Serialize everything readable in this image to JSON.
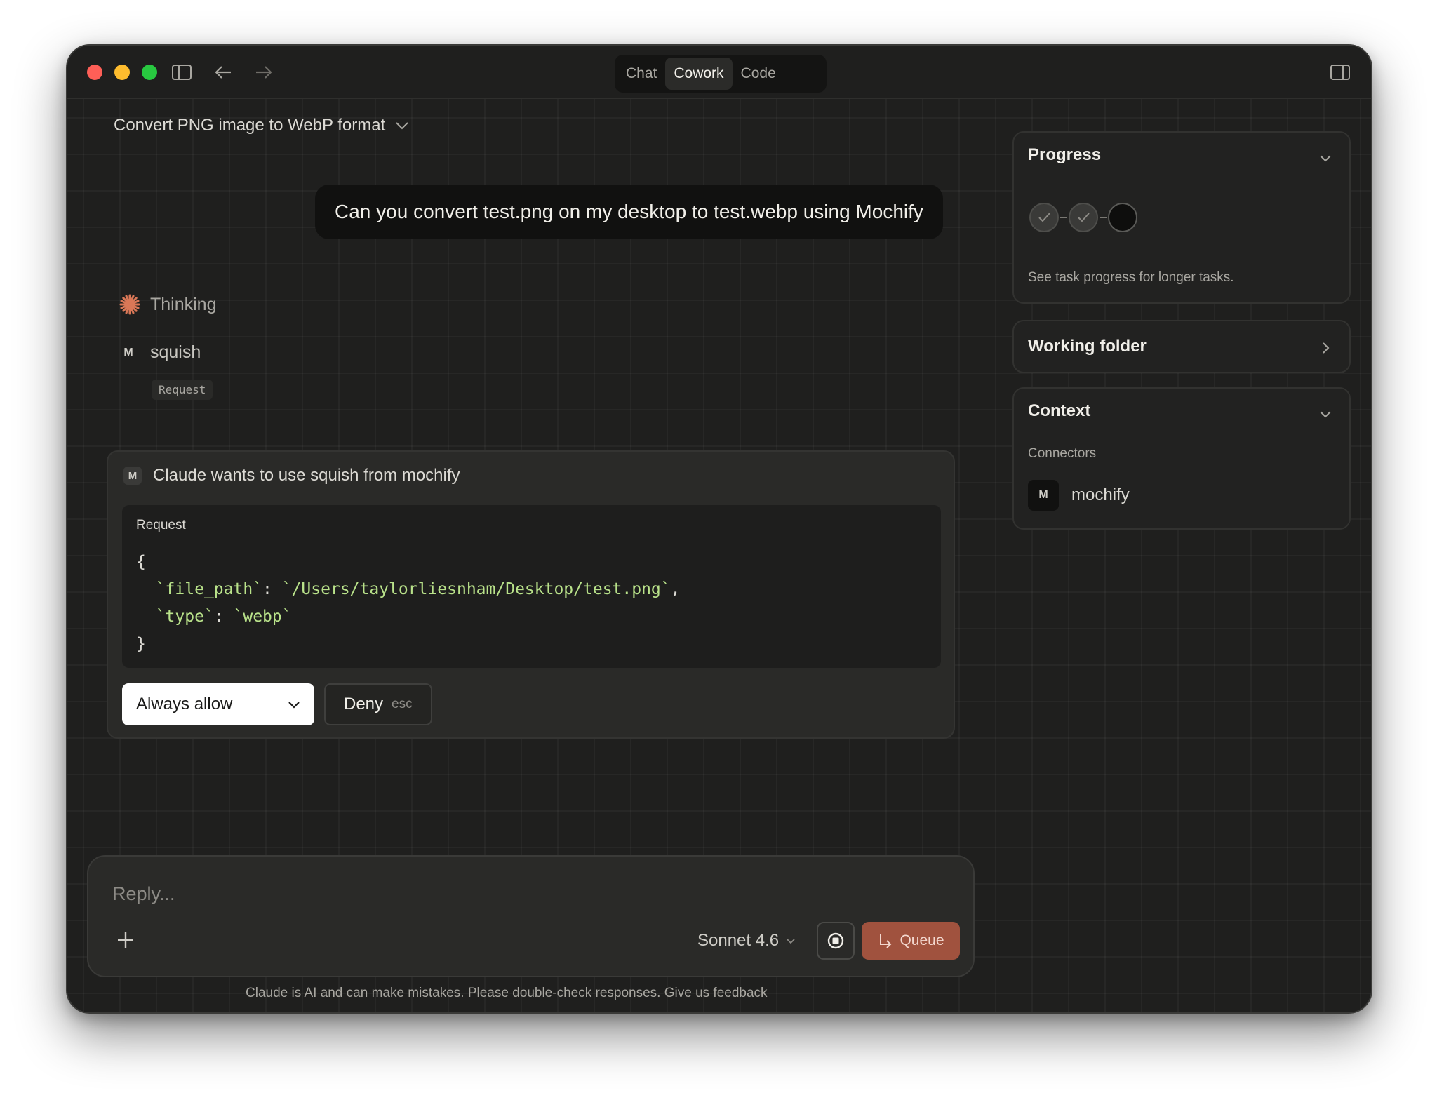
{
  "titlebar": {
    "tabs": [
      {
        "label": "Chat",
        "active": false
      },
      {
        "label": "Cowork",
        "active": true
      },
      {
        "label": "Code",
        "active": false
      }
    ]
  },
  "conversation": {
    "title": "Convert PNG image to WebP format",
    "user_message": "Can you convert test.png on my desktop to test.webp using Mochify",
    "thinking_label": "Thinking",
    "tool_badge": "M",
    "tool_name": "squish",
    "request_tag": "Request"
  },
  "permission": {
    "badge": "M",
    "heading": "Claude wants to use squish from mochify",
    "request_label": "Request",
    "code": {
      "open": "{",
      "key1": "`file_path`",
      "val1": "`/Users/taylorliesnham/Desktop/test.png`",
      "key2": "`type`",
      "val2": "`webp`",
      "close": "}"
    },
    "allow_label": "Always allow",
    "deny_label": "Deny",
    "deny_shortcut": "esc"
  },
  "composer": {
    "placeholder": "Reply...",
    "model": "Sonnet 4.6",
    "queue_label": "Queue"
  },
  "footer": {
    "disclaimer": "Claude is AI and can make mistakes. Please double-check responses.",
    "feedback_link": "Give us feedback"
  },
  "sidebar": {
    "progress": {
      "title": "Progress",
      "steps_completed": 2,
      "steps_total": 3,
      "description": "See task progress for longer tasks."
    },
    "working_folder": {
      "title": "Working folder"
    },
    "context": {
      "title": "Context",
      "connectors_label": "Connectors",
      "connector_badge": "M",
      "connector_name": "mochify"
    }
  },
  "colors": {
    "window_bg": "#1f1f1e",
    "accent_queue": "#a0523e",
    "code_string": "#b9e28a",
    "thinking_star": "#d97757"
  }
}
